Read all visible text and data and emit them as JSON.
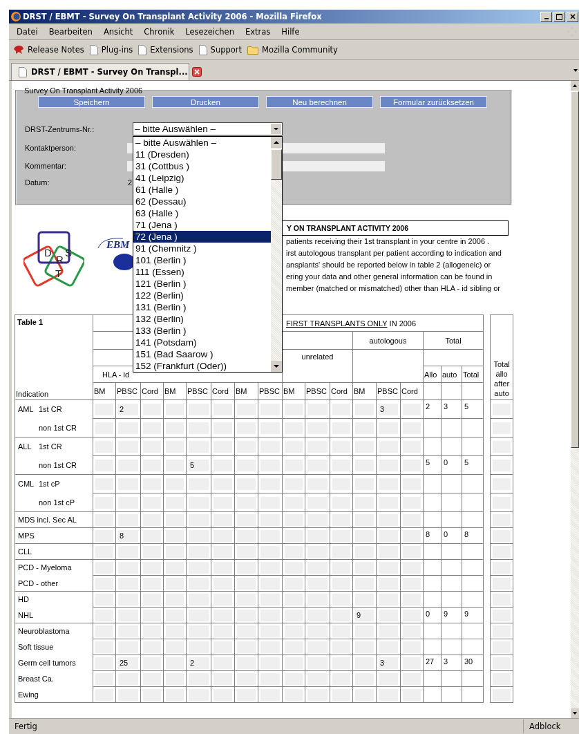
{
  "window": {
    "title": "DRST / EBMT - Survey On Transplant Activity 2006 - Mozilla Firefox"
  },
  "menu": [
    "Datei",
    "Bearbeiten",
    "Ansicht",
    "Chronik",
    "Lesezeichen",
    "Extras",
    "Hilfe"
  ],
  "bookmarks": [
    {
      "label": "Release Notes",
      "kind": "release"
    },
    {
      "label": "Plug-ins",
      "kind": "page"
    },
    {
      "label": "Extensions",
      "kind": "page"
    },
    {
      "label": "Support",
      "kind": "page"
    },
    {
      "label": "Mozilla Community",
      "kind": "folder"
    }
  ],
  "tab": {
    "title": "DRST / EBMT - Survey On Transpl..."
  },
  "form": {
    "legend": "Survey On Transplant Activity 2006",
    "buttons": [
      "Speichern",
      "Drucken",
      "Neu berechnen",
      "Formular zurücksetzen"
    ],
    "center_label": "DRST-Zentrums-Nr.:",
    "center_value": "– bitte Auswählen –",
    "options": [
      {
        "label": "– bitte Auswählen –",
        "selected": false
      },
      {
        "label": "11 (Dresden)",
        "selected": false
      },
      {
        "label": "31 (Cottbus )",
        "selected": false
      },
      {
        "label": "41 (Leipzig)",
        "selected": false
      },
      {
        "label": "61 (Halle )",
        "selected": false
      },
      {
        "label": "62 (Dessau)",
        "selected": false
      },
      {
        "label": "63 (Halle )",
        "selected": false
      },
      {
        "label": "71 (Jena )",
        "selected": false
      },
      {
        "label": "72 (Jena )",
        "selected": true
      },
      {
        "label": "91 (Chemnitz )",
        "selected": false
      },
      {
        "label": "101 (Berlin )",
        "selected": false
      },
      {
        "label": "111 (Essen)",
        "selected": false
      },
      {
        "label": "121 (Berlin )",
        "selected": false
      },
      {
        "label": "122 (Berlin)",
        "selected": false
      },
      {
        "label": "131 (Berlin )",
        "selected": false
      },
      {
        "label": "132 (Berlin)",
        "selected": false
      },
      {
        "label": "133 (Berlin )",
        "selected": false
      },
      {
        "label": "141 (Potsdam)",
        "selected": false
      },
      {
        "label": "151 (Bad Saarow )",
        "selected": false
      },
      {
        "label": "152 (Frankfurt (Oder))",
        "selected": false
      }
    ],
    "contact_label": "Kontaktperson:",
    "comment_label": "Kommentar:",
    "date_label": "Datum:",
    "date_value": "2"
  },
  "logos": {
    "drst_letters": [
      "D",
      "R",
      "S",
      "T"
    ],
    "ebmt_text": "EBM"
  },
  "heading": "Y ON TRANSPLANT ACTIVITY 2006",
  "intro_lines": [
    "patients receiving their 1st transplant in your centre in 2006 .",
    "irst autologous transplant per patient according to indication and",
    "ansplants' should be reported below in table 2 (allogeneic) or",
    "ering your data and other general information can be found in",
    "member (matched or mismatched) other than HLA - id sibling or"
  ],
  "table": {
    "title": "Table 1",
    "indication_label": "Indication",
    "caption_underlined": "FIRST TRANSPLANTS ONLY",
    "caption_rest": "IN 2006",
    "autologous": "autologous",
    "total": "Total",
    "unrelated": "unrelated",
    "hla": "HLA - id",
    "total_columns": [
      "Allo",
      "auto",
      "Total"
    ],
    "last_column": "Total allo after auto",
    "source_columns": [
      "BM",
      "PBSC",
      "Cord",
      "BM",
      "PBSC",
      "Cord",
      "BM",
      "PBSC",
      "BM",
      "PBSC",
      "Cord",
      "BM",
      "PBSC",
      "Cord"
    ],
    "groups": [
      {
        "rows": [
          {
            "disease": "AML",
            "stage": "1st CR",
            "cells": [
              null,
              "2",
              null,
              null,
              null,
              null,
              null,
              null,
              null,
              null,
              null,
              null,
              "3",
              null
            ],
            "totals": [
              "2",
              "3",
              "5"
            ]
          },
          {
            "stage": "non 1st CR"
          }
        ]
      },
      {
        "rows": [
          {
            "disease": "ALL",
            "stage": "1st CR"
          },
          {
            "stage": "non 1st CR",
            "cells": [
              null,
              null,
              null,
              null,
              "5",
              null,
              null,
              null,
              null,
              null,
              null,
              null,
              null,
              null
            ],
            "totals": [
              "5",
              "0",
              "5"
            ]
          }
        ]
      },
      {
        "rows": [
          {
            "disease": "CML",
            "stage": "1st cP"
          },
          {
            "stage": "non 1st cP"
          }
        ]
      },
      {
        "rows": [
          {
            "disease": "MDS incl. Sec AL"
          }
        ]
      },
      {
        "rows": [
          {
            "disease": "MPS",
            "cells": [
              null,
              "8",
              null,
              null,
              null,
              null,
              null,
              null,
              null,
              null,
              null,
              null,
              null,
              null
            ],
            "totals": [
              "8",
              "0",
              "8"
            ]
          }
        ]
      },
      {
        "rows": [
          {
            "disease": "CLL"
          }
        ]
      },
      {
        "rows": [
          {
            "disease": "PCD - Myeloma"
          },
          {
            "disease": "PCD - other"
          }
        ]
      },
      {
        "rows": [
          {
            "disease": "HD"
          },
          {
            "disease": "NHL",
            "cells": [
              null,
              null,
              null,
              null,
              null,
              null,
              null,
              null,
              null,
              null,
              null,
              "9",
              null,
              null
            ],
            "totals": [
              "0",
              "9",
              "9"
            ]
          }
        ]
      },
      {
        "rows": [
          {
            "disease": "Neuroblastoma"
          },
          {
            "disease": "Soft tissue"
          },
          {
            "disease": "Germ cell tumors",
            "cells": [
              null,
              "25",
              null,
              null,
              "2",
              null,
              null,
              null,
              null,
              null,
              null,
              null,
              "3",
              null
            ],
            "totals": [
              "27",
              "3",
              "30"
            ]
          },
          {
            "disease": "Breast Ca."
          },
          {
            "disease": "Ewing"
          }
        ]
      }
    ]
  },
  "status_bar": {
    "text": "Fertig",
    "panel": "Adblock"
  }
}
